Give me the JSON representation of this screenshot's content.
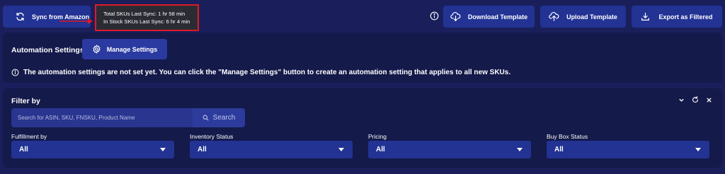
{
  "toolbar": {
    "sync_button": "Sync from Amazon",
    "sync_info": {
      "total_skus": "Total SKUs Last Sync: 1 hr 58 min",
      "in_stock_skus": "In Stock SKUs Last Sync: 6 hr 4 min"
    },
    "download_template": "Download Template",
    "upload_template": "Upload Template",
    "export_filtered": "Export as Filtered"
  },
  "automation": {
    "label": "Automation Settings",
    "manage_button": "Manage Settings",
    "notice": "The automation settings are not set yet. You can click the \"Manage Settings\" button to create an automation setting that applies to all new SKUs."
  },
  "filter": {
    "title": "Filter by",
    "search_placeholder": "Search for ASIN, SKU, FNSKU, Product Name",
    "search_button": "Search",
    "fields": [
      {
        "label": "Fulfillment by",
        "value": "All"
      },
      {
        "label": "Inventory Status",
        "value": "All"
      },
      {
        "label": "Pricing",
        "value": "All"
      },
      {
        "label": "Buy Box Status",
        "value": "All"
      }
    ]
  },
  "colors": {
    "background": "#1a1f5c",
    "panel": "#141a4a",
    "button": "#223394",
    "highlight_border": "#e01b24"
  },
  "icons": [
    "sync-icon",
    "info-icon",
    "download-icon",
    "upload-icon",
    "export-icon",
    "gear-icon",
    "chevron-down-icon",
    "refresh-icon",
    "close-icon",
    "search-icon"
  ]
}
